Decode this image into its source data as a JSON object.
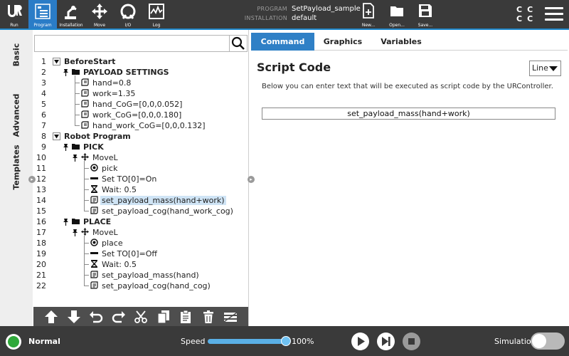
{
  "topbar": {
    "nav": [
      {
        "label": "Run",
        "icon": "ur-logo-icon"
      },
      {
        "label": "Program",
        "icon": "program-icon",
        "active": true
      },
      {
        "label": "Installation",
        "icon": "robot-arm-icon"
      },
      {
        "label": "Move",
        "icon": "move-arrows-icon"
      },
      {
        "label": "I/O",
        "icon": "io-icon"
      },
      {
        "label": "Log",
        "icon": "log-icon"
      }
    ],
    "program_key": "PROGRAM",
    "program_value": "SetPayload_sample",
    "installation_key": "INSTALLATION",
    "installation_value": "default",
    "file_buttons": [
      {
        "label": "New...",
        "icon": "new-file-icon"
      },
      {
        "label": "Open...",
        "icon": "folder-icon"
      },
      {
        "label": "Save...",
        "icon": "save-icon"
      }
    ],
    "cc_label": "CC CC",
    "accent_color": "#2a7cc7"
  },
  "left_tabs": [
    "Basic",
    "Advanced",
    "Templates"
  ],
  "search": {
    "value": "",
    "placeholder": ""
  },
  "tree": [
    {
      "n": "1",
      "text": "BeforeStart",
      "bold": true,
      "icon": "",
      "toggle": "collapse"
    },
    {
      "n": "2",
      "text": "PAYLOAD SETTINGS",
      "bold": true,
      "icon": "folder-icon",
      "toggle": "pin"
    },
    {
      "n": "3",
      "text": "hand=0.8",
      "icon": "assignment-icon"
    },
    {
      "n": "4",
      "text": "work=1.35",
      "icon": "assignment-icon"
    },
    {
      "n": "5",
      "text": "hand_CoG=[0,0,0.052]",
      "icon": "assignment-icon"
    },
    {
      "n": "6",
      "text": "work_CoG=[0,0,0.180]",
      "icon": "assignment-icon"
    },
    {
      "n": "7",
      "text": "hand_work_CoG=[0,0,0.132]",
      "icon": "assignment-icon"
    },
    {
      "n": "8",
      "text": "Robot Program",
      "bold": true,
      "icon": "",
      "toggle": "collapse"
    },
    {
      "n": "9",
      "text": "PICK",
      "bold": true,
      "icon": "folder-icon",
      "toggle": "pin"
    },
    {
      "n": "10",
      "text": "MoveL",
      "icon": "move-icon",
      "toggle": "pin"
    },
    {
      "n": "11",
      "text": "pick",
      "icon": "waypoint-icon"
    },
    {
      "n": "12",
      "text": "Set TO[0]=On",
      "icon": "set-icon"
    },
    {
      "n": "13",
      "text": "Wait: 0.5",
      "icon": "hourglass-icon"
    },
    {
      "n": "14",
      "text": "set_payload_mass(hand+work)",
      "icon": "script-icon",
      "selected": true
    },
    {
      "n": "15",
      "text": "set_payload_cog(hand_work_cog)",
      "icon": "script-icon"
    },
    {
      "n": "16",
      "text": "PLACE",
      "bold": true,
      "icon": "folder-icon",
      "toggle": "pin"
    },
    {
      "n": "17",
      "text": "MoveL",
      "icon": "move-icon",
      "toggle": "pin"
    },
    {
      "n": "18",
      "text": "place",
      "icon": "waypoint-icon"
    },
    {
      "n": "19",
      "text": "Set TO[0]=Off",
      "icon": "set-icon"
    },
    {
      "n": "20",
      "text": "Wait: 0.5",
      "icon": "hourglass-icon"
    },
    {
      "n": "21",
      "text": "set_payload_mass(hand)",
      "icon": "script-icon"
    },
    {
      "n": "22",
      "text": "set_payload_cog(hand_cog)",
      "icon": "script-icon"
    }
  ],
  "tree_tools": [
    "move-up-icon",
    "move-down-icon",
    "undo-icon",
    "redo-icon",
    "cut-icon",
    "copy-icon",
    "paste-icon",
    "delete-icon",
    "suppress-icon"
  ],
  "tabs": [
    {
      "label": "Command",
      "active": true
    },
    {
      "label": "Graphics"
    },
    {
      "label": "Variables"
    }
  ],
  "command": {
    "title": "Script Code",
    "mode_selected": "Line",
    "description": "Below you can enter text that will be executed as script code by the URController.",
    "code": "set_payload_mass(hand+work)"
  },
  "footer": {
    "status": "Normal",
    "status_color": "#2fa83a",
    "speed_label": "Speed",
    "speed_value": "100%",
    "speed_fraction": 1.0,
    "controls": [
      "play-icon",
      "step-icon",
      "stop-icon"
    ],
    "simulation_label": "Simulation",
    "simulation_on": false
  }
}
